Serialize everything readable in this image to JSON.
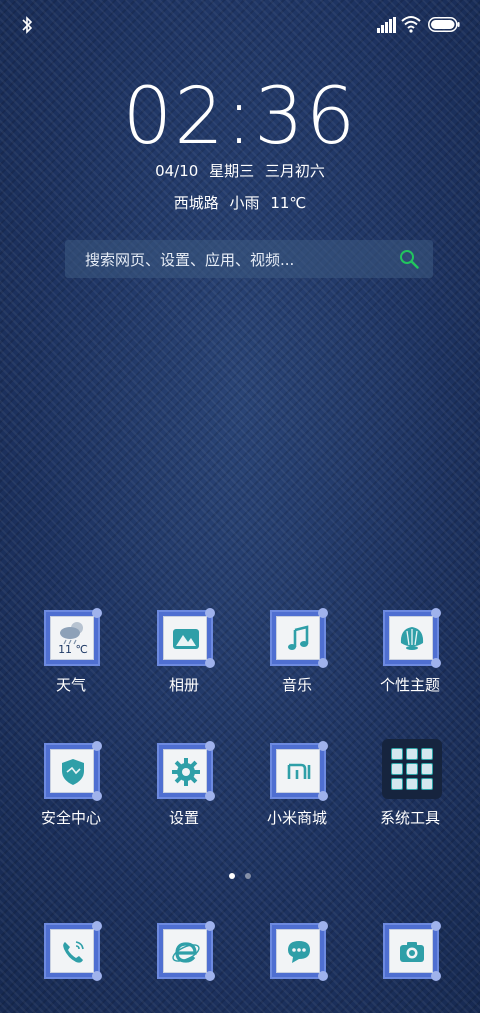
{
  "status_bar": {
    "icons": [
      "bluetooth-icon",
      "signal-icon",
      "wifi-icon",
      "battery-icon"
    ]
  },
  "lockscreen": {
    "time": "02:36",
    "date": "04/10",
    "weekday": "星期三",
    "lunar": "三月初六",
    "location": "西城路",
    "weather": "小雨",
    "temperature": "11℃"
  },
  "search": {
    "placeholder": "搜索网页、设置、应用、视频..."
  },
  "apps_row1": [
    {
      "label": "天气",
      "icon": "weather-icon",
      "temp": "11 ℃"
    },
    {
      "label": "相册",
      "icon": "gallery-icon"
    },
    {
      "label": "音乐",
      "icon": "music-icon"
    },
    {
      "label": "个性主题",
      "icon": "themes-icon"
    }
  ],
  "apps_row2": [
    {
      "label": "安全中心",
      "icon": "security-icon"
    },
    {
      "label": "设置",
      "icon": "settings-icon"
    },
    {
      "label": "小米商城",
      "icon": "mi-store-icon"
    },
    {
      "label": "系统工具",
      "icon": "system-tools-icon"
    }
  ],
  "dock": [
    {
      "icon": "phone-icon"
    },
    {
      "icon": "browser-icon"
    },
    {
      "icon": "messages-icon"
    },
    {
      "icon": "camera-icon"
    }
  ],
  "pager": {
    "current_page": 1,
    "total_pages": 2
  },
  "colors": {
    "accent": "#2f9fa8",
    "tile_border": "#4f6fd1",
    "search_icon": "#22c55e"
  }
}
